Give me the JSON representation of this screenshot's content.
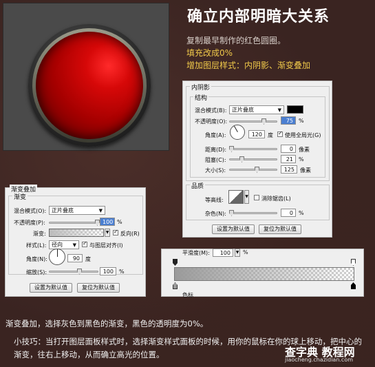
{
  "title": "确立内部明暗大关系",
  "intro": {
    "line1": "复制最早制作的红色圆圈。",
    "line2": "填充改成0%",
    "line3": "增加图层样式：内阴影、渐变叠加"
  },
  "inner_shadow": {
    "legend": "内阴影",
    "structure_legend": "结构",
    "blend_label": "混合模式(B):",
    "blend_value": "正片叠底",
    "opacity_label": "不透明度(O):",
    "opacity_value": "75",
    "opacity_unit": "%",
    "angle_label": "角度(A):",
    "angle_value": "120",
    "angle_unit": "度",
    "global_light_label": "使用全局光(G)",
    "distance_label": "距离(D):",
    "distance_value": "0",
    "distance_unit": "像素",
    "choke_label": "阻塞(C):",
    "choke_value": "21",
    "choke_unit": "%",
    "size_label": "大小(S):",
    "size_value": "125",
    "size_unit": "像素",
    "quality_legend": "品质",
    "contour_label": "等高线:",
    "antialias_label": "消除锯齿(L)",
    "noise_label": "杂色(N):",
    "noise_value": "0",
    "noise_unit": "%",
    "default_btn": "设置为默认值",
    "reset_btn": "复位为默认值",
    "color": "#000000"
  },
  "gradient_overlay": {
    "legend": "渐变叠加",
    "sub_legend": "渐变",
    "blend_label": "混合模式(O):",
    "blend_value": "正片叠底",
    "opacity_label": "不透明度(P):",
    "opacity_value": "100",
    "opacity_unit": "%",
    "gradient_label": "渐变:",
    "reverse_label": "反向(R)",
    "style_label": "样式(L):",
    "style_value": "径向",
    "align_label": "与图层对齐(I)",
    "angle_label": "角度(N):",
    "angle_value": "90",
    "angle_unit": "度",
    "scale_label": "缩放(S):",
    "scale_value": "100",
    "scale_unit": "%",
    "default_btn": "设置为默认值",
    "reset_btn": "复位为默认值"
  },
  "gradient_editor": {
    "smoothness_label": "平滑度(M):",
    "smoothness_value": "100",
    "smoothness_unit": "%",
    "stops_label": "色标"
  },
  "footer": {
    "line1": "渐变叠加，选择灰色到黑色的渐变，黑色的透明度为0%。",
    "line2": "小技巧：当打开图层面板样式时，选择渐变样式面板的时候，用你的鼠标在你的球上移动，把中心的渐变，往右上移动，从而确立高光的位置。"
  },
  "watermark": {
    "main": "查字典 教程网",
    "url": "jiaocheng.chazidian.com"
  },
  "colors": {
    "ball": "#cc0000",
    "accent_text": "#f0c94a"
  }
}
